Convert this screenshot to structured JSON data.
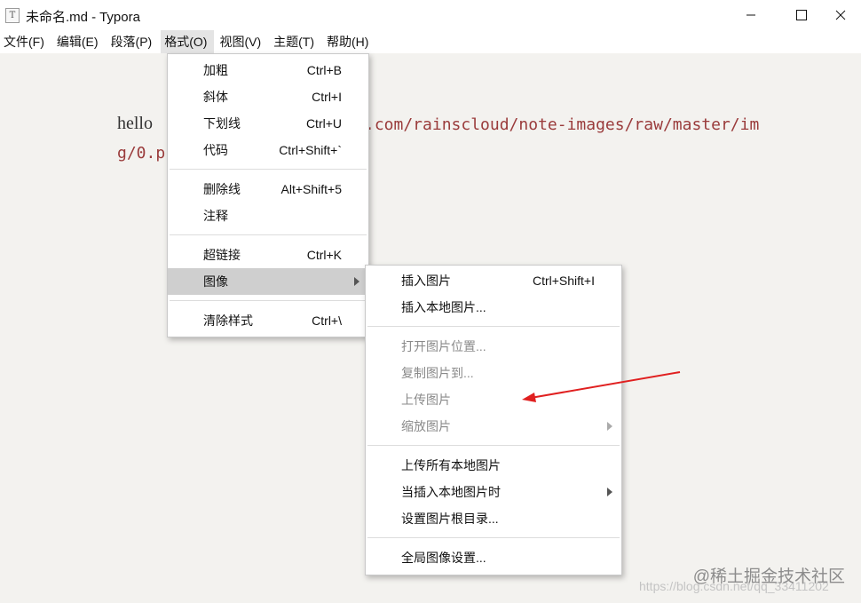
{
  "window": {
    "title": "未命名.md - Typora",
    "app_icon_glyph": "T"
  },
  "menubar": {
    "items": [
      {
        "label": "文件(F)"
      },
      {
        "label": "编辑(E)"
      },
      {
        "label": "段落(P)"
      },
      {
        "label": "格式(O)",
        "active": true
      },
      {
        "label": "视图(V)"
      },
      {
        "label": "主题(T)"
      },
      {
        "label": "帮助(H)"
      }
    ]
  },
  "editor": {
    "hello": "hello",
    "line1": ".com/rainscloud/note-images/raw/master/im",
    "line2": "g/0.p"
  },
  "format_menu": {
    "items": [
      {
        "label": "加粗",
        "shortcut": "Ctrl+B"
      },
      {
        "label": "斜体",
        "shortcut": "Ctrl+I"
      },
      {
        "label": "下划线",
        "shortcut": "Ctrl+U"
      },
      {
        "label": "代码",
        "shortcut": "Ctrl+Shift+`"
      },
      {
        "label": "删除线",
        "shortcut": "Alt+Shift+5"
      },
      {
        "label": "注释",
        "shortcut": ""
      },
      {
        "label": "超链接",
        "shortcut": "Ctrl+K"
      },
      {
        "label": "图像",
        "shortcut": "",
        "selected": true
      },
      {
        "label": "清除样式",
        "shortcut": "Ctrl+\\"
      }
    ]
  },
  "image_menu": {
    "items": [
      {
        "label": "插入图片",
        "shortcut": "Ctrl+Shift+I"
      },
      {
        "label": "插入本地图片...",
        "shortcut": ""
      },
      {
        "label": "打开图片位置...",
        "disabled": true
      },
      {
        "label": "复制图片到...",
        "disabled": true
      },
      {
        "label": "上传图片",
        "disabled": true
      },
      {
        "label": "缩放图片",
        "disabled": true
      },
      {
        "label": "上传所有本地图片"
      },
      {
        "label": "当插入本地图片时"
      },
      {
        "label": "设置图片根目录..."
      },
      {
        "label": "全局图像设置..."
      }
    ]
  },
  "watermark": {
    "text": "@稀土掘金技术社区",
    "url": "https://blog.csdn.net/qq_33411202"
  },
  "colors": {
    "annotation_arrow": "#e02020",
    "editor_bg": "#f3f2ef",
    "selected_item": "#cfcfcf"
  }
}
